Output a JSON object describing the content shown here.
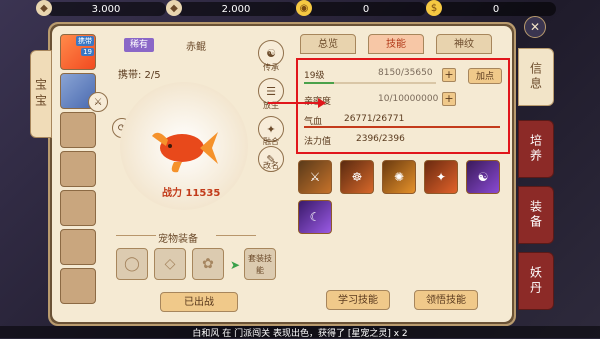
{
  "currency": {
    "c1": "3.000",
    "c2": "2.000",
    "c3": "0",
    "c4": "0"
  },
  "pet_tab": "宝宝",
  "slot1": {
    "badge": "携带",
    "level": "19"
  },
  "rarity": "稀有",
  "pet_name": "赤鲲",
  "carry": "携带: 2/5",
  "power": "战力 11535",
  "side_buttons": [
    "传承",
    "放生",
    "融合",
    "改名",
    "图鉴"
  ],
  "equip_title": "宠物装备",
  "suit_label": "套装技能",
  "dispatch_label": "已出战",
  "tabs": [
    "总览",
    "技能",
    "神纹"
  ],
  "stats": {
    "level_label": "19级",
    "level_value": "8150/35650",
    "level_ratio": 0.23,
    "intimacy_label": "亲密度",
    "intimacy_value": "10/10000000",
    "intimacy_ratio": 0.0,
    "hp_label": "气血",
    "hp_value": "26771/26771",
    "hp_ratio": 1.0,
    "mp_label": "法力值",
    "mp_value": "2396/2396",
    "mp_ratio": 1.0,
    "add_point": "加点"
  },
  "skill_buttons": {
    "learn": "学习技能",
    "comprehend": "领悟技能"
  },
  "right_nav": [
    "信息",
    "培养",
    "装备",
    "妖丹"
  ],
  "message": "白和风 在 门派闯关 表现出色，获得了 [星宠之灵] x 2"
}
